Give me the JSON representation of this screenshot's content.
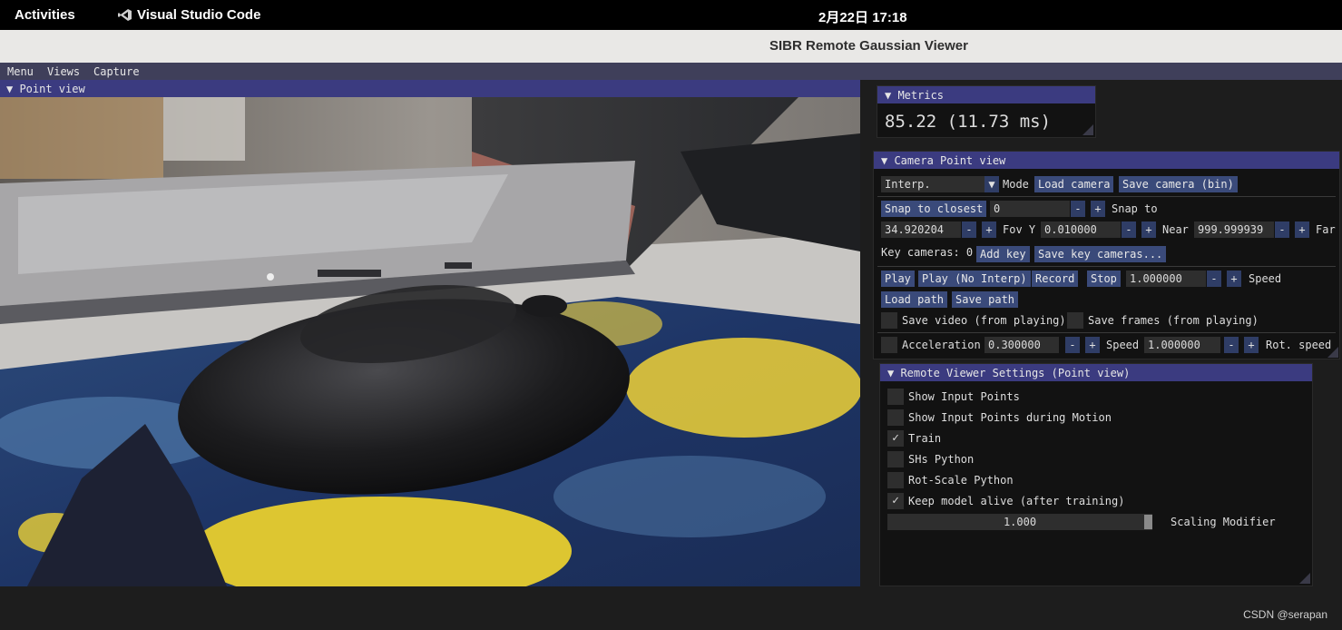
{
  "topbar": {
    "activities": "Activities",
    "app_name": "Visual Studio Code",
    "clock": "2月22日  17:18"
  },
  "window": {
    "title": "SIBR Remote Gaussian Viewer"
  },
  "menubar": {
    "items": [
      "Menu",
      "Views",
      "Capture"
    ]
  },
  "point_view": {
    "title": "▼ Point view"
  },
  "metrics": {
    "title": "▼ Metrics",
    "value": "85.22 (11.73 ms)"
  },
  "camera": {
    "title": "▼ Camera Point view",
    "mode_value": "Interp.",
    "mode_label": "Mode",
    "load_camera": "Load camera",
    "save_camera": "Save camera (bin)",
    "snap_button": "Snap to closest",
    "snap_value": "0",
    "snap_label": "Snap to",
    "fov_value": "34.920204",
    "fov_label": "Fov Y",
    "near_value": "0.010000",
    "near_label": "Near",
    "far_value": "999.999939",
    "far_label": "Far",
    "key_cameras_label": "Key cameras: 0",
    "add_key": "Add key",
    "save_key_cameras": "Save key cameras...",
    "play": "Play",
    "play_no_interp": "Play (No Interp)",
    "record": "Record",
    "stop": "Stop",
    "speed_value": "1.000000",
    "speed_label": "Speed",
    "load_path": "Load path",
    "save_path": "Save path",
    "save_video": "Save video (from playing)",
    "save_frames": "Save frames (from playing)",
    "acceleration_label": "Acceleration",
    "acceleration_value": "0.300000",
    "move_speed_label": "Speed",
    "move_speed_value": "1.000000",
    "rot_speed_label": "Rot. speed",
    "minus": "-",
    "plus": "+"
  },
  "remote": {
    "title": "▼ Remote Viewer Settings (Point view)",
    "options": [
      {
        "label": "Show Input Points",
        "checked": false
      },
      {
        "label": "Show Input Points during Motion",
        "checked": false
      },
      {
        "label": "Train",
        "checked": true
      },
      {
        "label": "SHs Python",
        "checked": false
      },
      {
        "label": "Rot-Scale Python",
        "checked": false
      },
      {
        "label": "Keep model alive (after training)",
        "checked": true
      }
    ],
    "check_mark": "✓",
    "scaling_value": "1.000",
    "scaling_label": "Scaling Modifier"
  },
  "watermark": "CSDN @serapan",
  "colors": {
    "header": "#3b3b80",
    "button": "#3a4a7a",
    "panel_bg": "#121212",
    "menubar": "#3f3f5a"
  },
  "icons": {
    "app_icon": "vscode-icon",
    "dropdown": "▼"
  }
}
